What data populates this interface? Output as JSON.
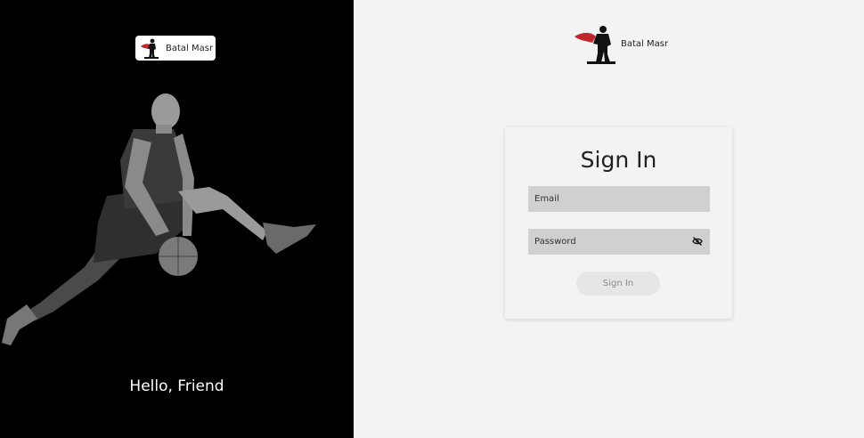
{
  "brand": {
    "name": "Batal Masr"
  },
  "left_panel": {
    "greeting": "Hello, Friend"
  },
  "signin_card": {
    "title": "Sign In",
    "email_placeholder": "Email",
    "password_placeholder": "Password",
    "submit_label": "Sign In"
  },
  "icons": {
    "logo": "superhero-logo-icon",
    "password_visibility": "eye-slash-icon"
  },
  "colors": {
    "left_background": "#000000",
    "right_background": "#f3f3f3",
    "field_background": "#d0d0d0",
    "button_background": "#e6e6e6",
    "logo_cape": "#c0262d"
  }
}
